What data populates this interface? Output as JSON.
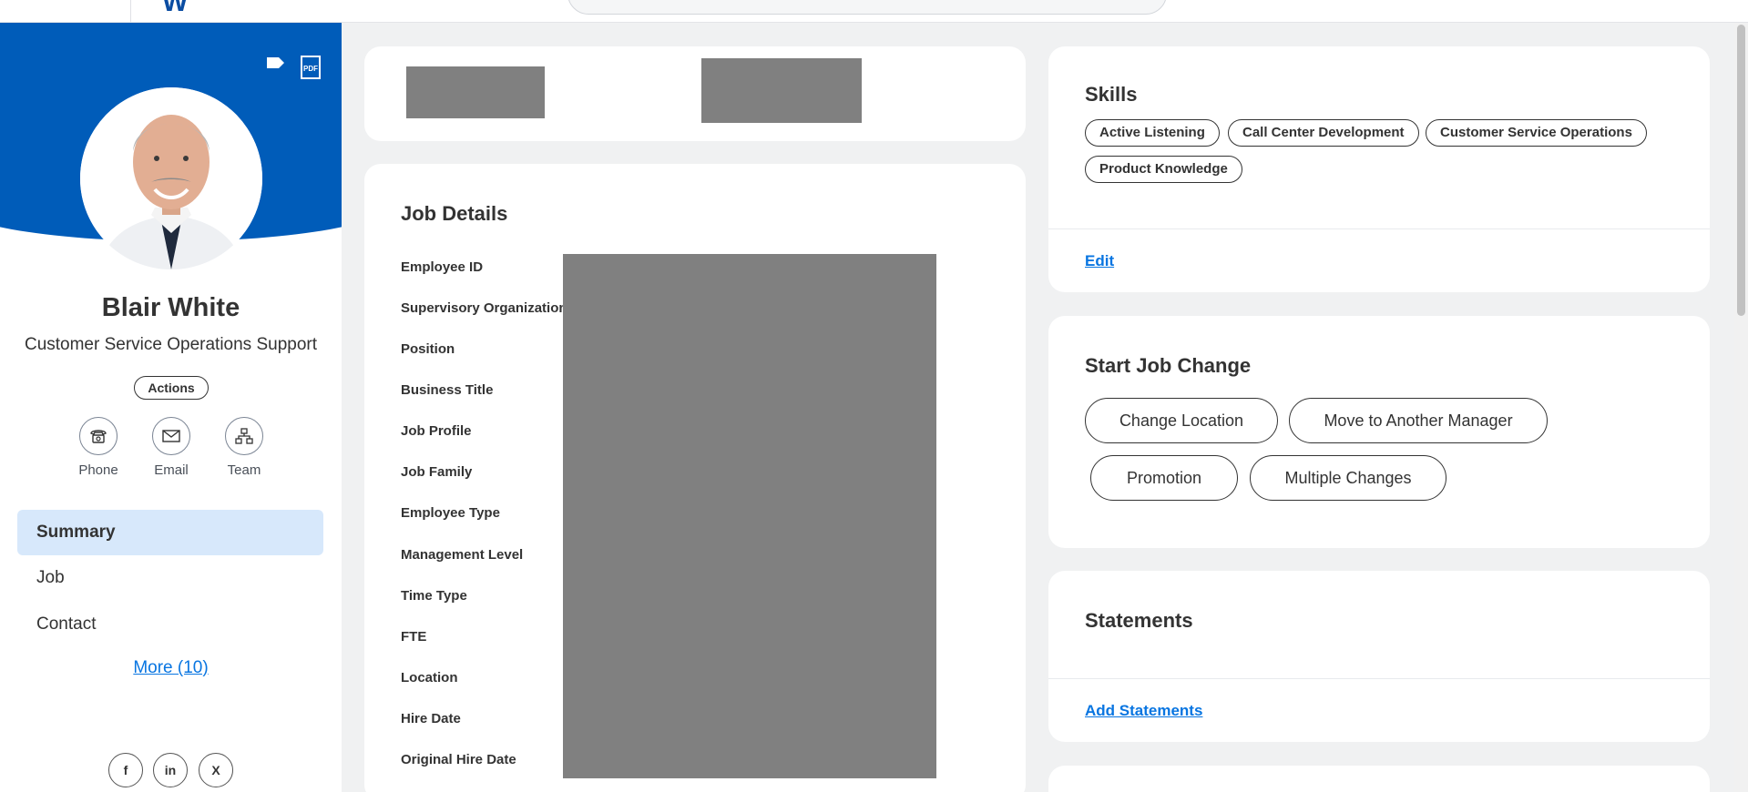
{
  "topbar": {
    "logo_text": "W"
  },
  "profile": {
    "name": "Blair White",
    "title": "Customer Service Operations Support",
    "actions_label": "Actions",
    "contacts": [
      {
        "label": "Phone",
        "icon": "phone-icon"
      },
      {
        "label": "Email",
        "icon": "email-icon"
      },
      {
        "label": "Team",
        "icon": "team-icon"
      }
    ],
    "nav": [
      {
        "label": "Summary",
        "active": true
      },
      {
        "label": "Job",
        "active": false
      },
      {
        "label": "Contact",
        "active": false
      }
    ],
    "more_label": "More (10)",
    "social": [
      {
        "label": "f",
        "icon": "facebook-icon"
      },
      {
        "label": "in",
        "icon": "linkedin-icon"
      },
      {
        "label": "X",
        "icon": "x-icon"
      }
    ]
  },
  "job_details": {
    "title": "Job Details",
    "fields": [
      "Employee ID",
      "Supervisory Organization",
      "Position",
      "Business Title",
      "Job Profile",
      "Job Family",
      "Employee Type",
      "Management Level",
      "Time Type",
      "FTE",
      "Location",
      "Hire Date",
      "Original Hire Date"
    ]
  },
  "skills": {
    "title": "Skills",
    "chips": [
      "Active Listening",
      "Call Center Development",
      "Customer Service Operations",
      "Product Knowledge"
    ],
    "edit_label": "Edit"
  },
  "job_change": {
    "title": "Start Job Change",
    "buttons": [
      "Change Location",
      "Move to Another Manager",
      "Promotion",
      "Multiple Changes"
    ]
  },
  "statements": {
    "title": "Statements",
    "add_label": "Add Statements"
  },
  "colors": {
    "brand": "#005cb9",
    "link": "#0875e1",
    "nav_active": "#d7e8fb",
    "redaction": "#808080"
  }
}
